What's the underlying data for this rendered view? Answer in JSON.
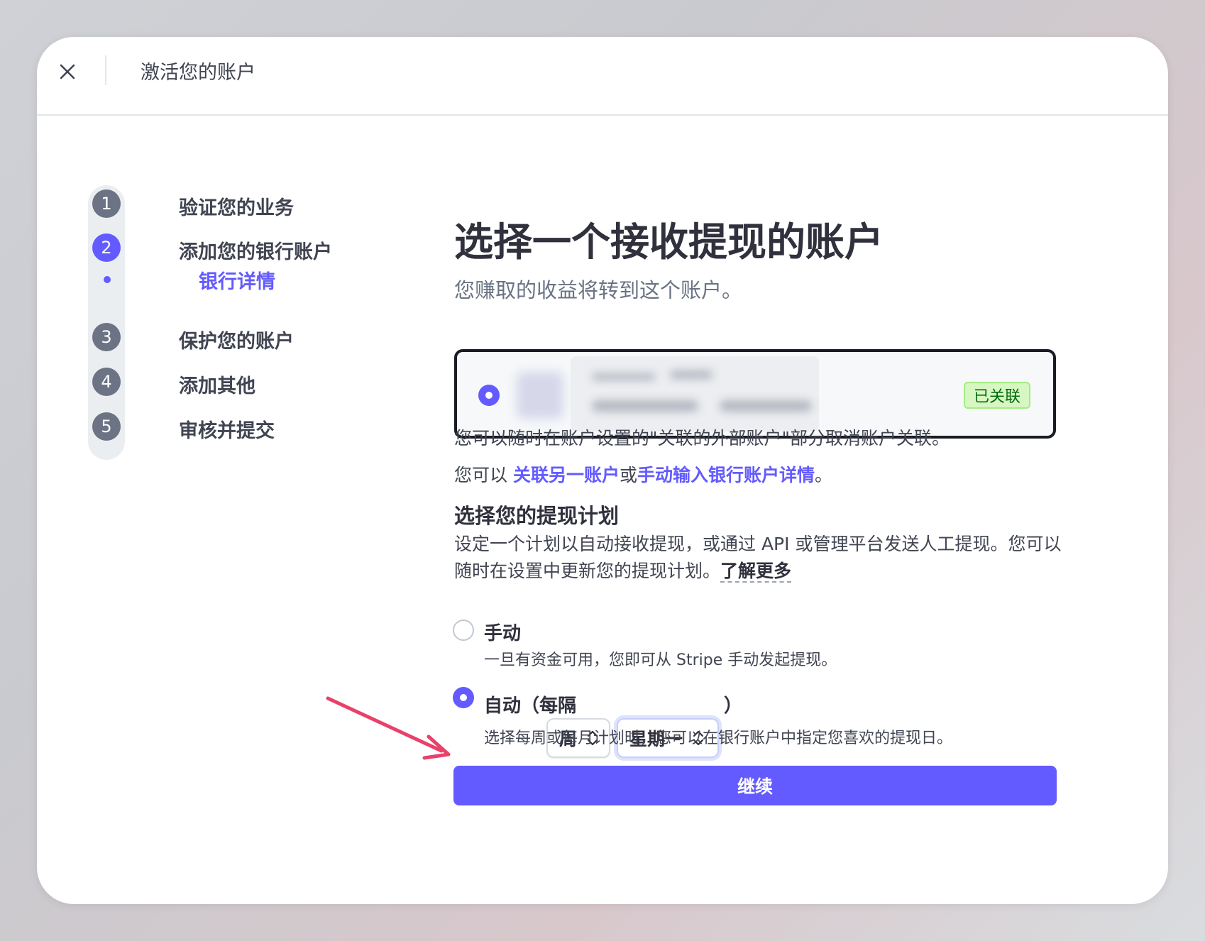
{
  "header": {
    "title": "激活您的账户",
    "close_icon": "close-icon"
  },
  "steps": [
    {
      "number": "1",
      "label": "验证您的业务"
    },
    {
      "number": "2",
      "label": "添加您的银行账户",
      "active": true
    },
    {
      "number": "3",
      "label": "保护您的账户"
    },
    {
      "number": "4",
      "label": "添加其他"
    },
    {
      "number": "5",
      "label": "审核并提交"
    }
  ],
  "substep": {
    "label": "银行详情"
  },
  "main": {
    "heading": "选择一个接收提现的账户",
    "subheading": "您赚取的收益将转到这个账户。",
    "account_card": {
      "badge": "已关联",
      "selected": true
    },
    "unlink_note": "您可以随时在账户设置的\"关联的外部账户\"部分取消账户关联。",
    "link_note": {
      "prefix": "您可以 ",
      "link_another": "关联另一账户",
      "middle": "或",
      "manual_entry": "手动输入银行账户详情",
      "suffix": "。"
    },
    "schedule": {
      "title": "选择您的提现计划",
      "description": "设定一个计划以自动接收提现，或通过 API 或管理平台发送人工提现。您可以随时在设置中更新您的提现计划。",
      "learn_more": "了解更多",
      "manual": {
        "label": "手动",
        "description": "一旦有资金可用，您即可从 Stripe 手动发起提现。",
        "selected": false
      },
      "automatic": {
        "label_prefix": "自动（每隔",
        "label_suffix": "）",
        "interval_value": "周",
        "day_value": "星期一",
        "description": "选择每周或每月计划时，您可以在银行账户中指定您喜欢的提现日。",
        "selected": true
      }
    },
    "continue_label": "继续"
  },
  "colors": {
    "accent": "#635bff",
    "badge_bg": "#d7f7c2",
    "badge_text": "#05690d",
    "annotation_arrow": "#e8416a"
  }
}
